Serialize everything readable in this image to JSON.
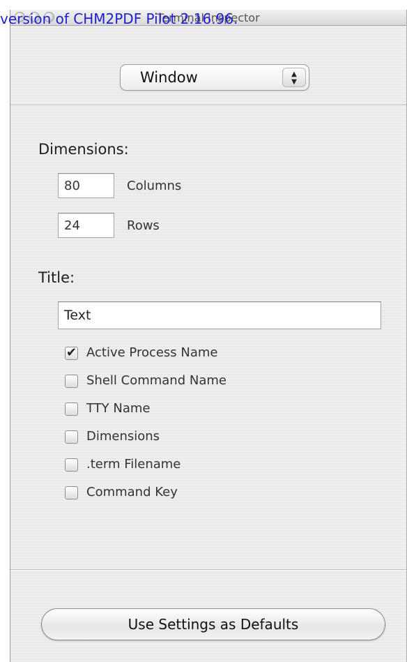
{
  "overlay": {
    "text": "version of CHM2PDF Pilot 2.16.96."
  },
  "window": {
    "title": "Terminal Inspector"
  },
  "popup": {
    "selected": "Window"
  },
  "dimensions": {
    "label": "Dimensions:",
    "columns_value": "80",
    "columns_label": "Columns",
    "rows_value": "24",
    "rows_label": "Rows"
  },
  "title_section": {
    "label": "Title:",
    "field_value": "Text",
    "options": [
      {
        "label": "Active Process Name",
        "checked": true
      },
      {
        "label": "Shell Command Name",
        "checked": false
      },
      {
        "label": "TTY Name",
        "checked": false
      },
      {
        "label": "Dimensions",
        "checked": false
      },
      {
        "label": ".term Filename",
        "checked": false
      },
      {
        "label": "Command Key",
        "checked": false
      }
    ]
  },
  "footer": {
    "button_label": "Use Settings as Defaults"
  }
}
